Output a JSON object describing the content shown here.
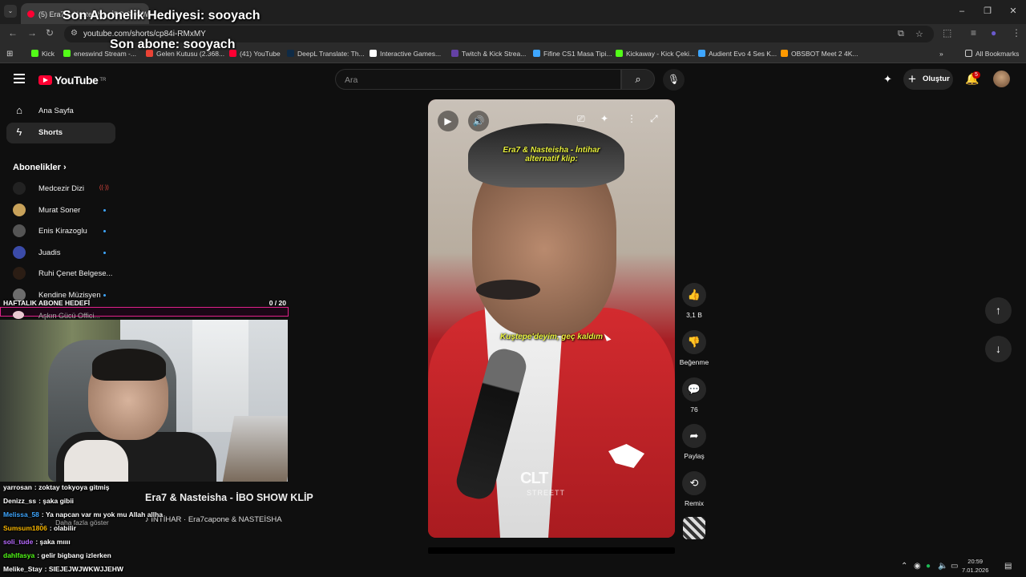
{
  "browser": {
    "tab_title": "(5) Era7 & Nasteisha - İBO SHOW",
    "url": "youtube.com/shorts/cp84i-RMxMY",
    "bookmarks": [
      {
        "label": "Kick",
        "color": "#53fc18"
      },
      {
        "label": "eneswind Stream -...",
        "color": "#53fc18"
      },
      {
        "label": "Gelen Kutusu (2.368...",
        "color": "#ea4335"
      },
      {
        "label": "(41) YouTube",
        "color": "#ff0033"
      },
      {
        "label": "DeepL Translate: Th...",
        "color": "#0f2b46"
      },
      {
        "label": "Interactive Games...",
        "color": "#ffffff"
      },
      {
        "label": "Twitch & Kick Strea...",
        "color": "#6441a5"
      },
      {
        "label": "Fifine CS1 Masa Tipi...",
        "color": "#3ea6ff"
      },
      {
        "label": "Kickaway - Kick Çeki...",
        "color": "#53fc18"
      },
      {
        "label": "Audient Evo 4 Ses K...",
        "color": "#3ea6ff"
      },
      {
        "label": "OBSBOT Meet 2 4K...",
        "color": "#ff9900"
      }
    ],
    "all_bookmarks": "All Bookmarks"
  },
  "overlay": {
    "last_gift": "Son Abonelik Hediyesi: sooyach",
    "last_sub": "Son abone: sooyach",
    "goal_label": "HAFTALIK ABONE HEDEFİ",
    "goal_value": "0 / 20",
    "goal_fraction": 0
  },
  "youtube": {
    "logo": "YouTube",
    "logo_region": "TR",
    "search_placeholder": "Ara",
    "create_label": "Oluştur",
    "notification_count": "5",
    "sidebar": [
      {
        "label": "Ana Sayfa",
        "icon": "home-icon"
      },
      {
        "label": "Shorts",
        "icon": "shorts-icon"
      }
    ],
    "subscriptions_title": "Abonelikler",
    "subscriptions": [
      {
        "name": "Medcezir Dizi",
        "color": "#222",
        "live": true
      },
      {
        "name": "Murat Soner",
        "color": "#c8a25a",
        "live": false
      },
      {
        "name": "Enis Kirazoglu",
        "color": "#555",
        "live": false
      },
      {
        "name": "Juadis",
        "color": "#3b4ba8",
        "live": false
      },
      {
        "name": "Ruhi Çenet Belgese...",
        "color": "#2b1d14",
        "live": false
      },
      {
        "name": "Kendine Müzisyen",
        "color": "#6d6d6d",
        "live": false
      },
      {
        "name": "Aşkın Gücü Offici...",
        "color": "#e9c9d2",
        "live": false
      }
    ],
    "more_label": "Daha fazla göster",
    "short": {
      "title": "Era7 & Nasteisha - İBO SHOW KLİP",
      "sound": "İNTİHAR · Era7capone & NASTEİSHA",
      "caption_top": "Era7 & Nasteisha - İntihar\nalternatif klip:",
      "caption_mid": "Kuştepe'deyim, geç kaldım",
      "watermark": "CLT",
      "watermark_sub": "STREETT"
    },
    "actions": {
      "like": "3,1 B",
      "dislike": "Beğenme",
      "comments": "76",
      "share": "Paylaş",
      "remix": "Remix"
    }
  },
  "chat": [
    {
      "user": "yarrosan",
      "color": "#ffffff",
      "msg": ": zoktay tokyoya gitmiş"
    },
    {
      "user": "Denizz_ss",
      "color": "#ffffff",
      "msg": ": şaka gibii"
    },
    {
      "user": "Melissa_58",
      "color": "#3ea6ff",
      "msg": ": Ya napcan var mı yok mu Allah allha"
    },
    {
      "user": "Sumsum1806",
      "color": "#f7b500",
      "msg": ": olabilir"
    },
    {
      "user": "soli_tude",
      "color": "#b86bff",
      "msg": ": şaka mıııı"
    },
    {
      "user": "dahlfasya",
      "color": "#53fc18",
      "msg": ": gelir bigbang izlerken"
    },
    {
      "user": "Melike_Stay",
      "color": "#ffffff",
      "msg": ": SIEJEJWJWKWJJEHW"
    }
  ],
  "taskbar": {
    "time": "20:59",
    "date": "7.01.2026"
  }
}
